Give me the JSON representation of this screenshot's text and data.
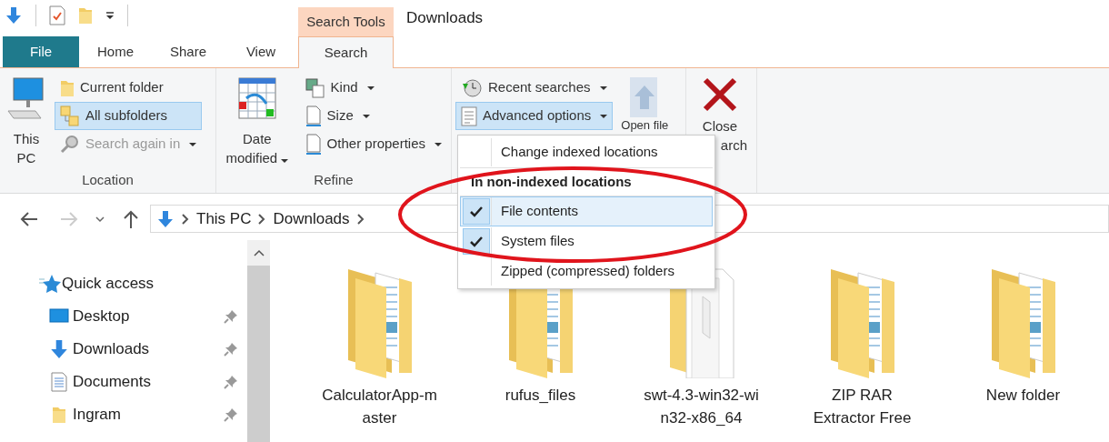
{
  "window": {
    "title": "Downloads",
    "contextual_tab": "Search Tools"
  },
  "tabs": [
    {
      "label": "File",
      "kind": "file",
      "selected": false
    },
    {
      "label": "Home",
      "kind": "tab",
      "selected": false
    },
    {
      "label": "Share",
      "kind": "tab",
      "selected": false
    },
    {
      "label": "View",
      "kind": "tab",
      "selected": false
    },
    {
      "label": "Search",
      "kind": "contextual",
      "selected": true
    }
  ],
  "ribbon": {
    "location": {
      "label": "Location",
      "this_pc": "This PC",
      "scope": [
        {
          "label": "Current folder",
          "selected": false
        },
        {
          "label": "All subfolders",
          "selected": true
        }
      ],
      "search_again": {
        "label": "Search again in",
        "disabled": true
      }
    },
    "refine": {
      "label": "Refine",
      "date_modified": "Date modified",
      "filters": [
        {
          "label": "Kind"
        },
        {
          "label": "Size"
        },
        {
          "label": "Other properties"
        }
      ]
    },
    "options": {
      "recent_searches": "Recent searches",
      "advanced_options": {
        "label": "Advanced options",
        "expanded": true
      },
      "open_file_location": "Open file"
    },
    "close_search": [
      "Close",
      "arch"
    ]
  },
  "advanced_menu": [
    {
      "kind": "command",
      "label": "Change indexed locations"
    },
    {
      "kind": "header",
      "label": "In non-indexed locations"
    },
    {
      "kind": "check",
      "label": "File contents",
      "checked": true,
      "selected": true
    },
    {
      "kind": "check",
      "label": "System files",
      "checked": true,
      "selected": false
    },
    {
      "kind": "check",
      "label": "Zipped (compressed) folders",
      "checked": false,
      "selected": false
    }
  ],
  "address_bar": {
    "breadcrumbs": [
      "This PC",
      "Downloads"
    ]
  },
  "navigation_pane": [
    {
      "label": "Quick access",
      "kind": "quick",
      "pinned": false
    },
    {
      "label": "Desktop",
      "kind": "desktop",
      "pinned": true
    },
    {
      "label": "Downloads",
      "kind": "downloads",
      "pinned": true
    },
    {
      "label": "Documents",
      "kind": "documents",
      "pinned": true
    },
    {
      "label": "Ingram",
      "kind": "folder",
      "pinned": true
    }
  ],
  "files": [
    {
      "name": "CalculatorApp-master",
      "kind": "folder"
    },
    {
      "name": "rufus_files",
      "kind": "folder"
    },
    {
      "name": "swt-4.3-win32-win32-x86_64",
      "kind": "zip"
    },
    {
      "name": "ZIP RAR Extractor Free",
      "kind": "folder"
    },
    {
      "name": "New folder",
      "kind": "folder"
    }
  ]
}
